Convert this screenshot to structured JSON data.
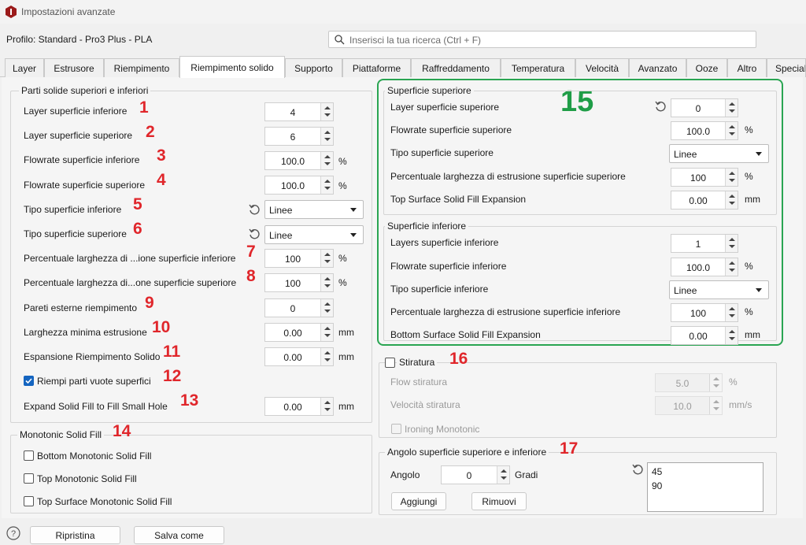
{
  "window": {
    "title": "Impostazioni avanzate"
  },
  "profile": {
    "label": "Profilo: Standard - Pro3 Plus - PLA"
  },
  "search": {
    "placeholder": "Inserisci la tua ricerca (Ctrl + F)"
  },
  "tabs": [
    {
      "label": "Layer"
    },
    {
      "label": "Estrusore"
    },
    {
      "label": "Riempimento"
    },
    {
      "label": "Riempimento solido"
    },
    {
      "label": "Supporto"
    },
    {
      "label": "Piattaforme"
    },
    {
      "label": "Raffreddamento"
    },
    {
      "label": "Temperatura"
    },
    {
      "label": "Velocità"
    },
    {
      "label": "Avanzato"
    },
    {
      "label": "Ooze"
    },
    {
      "label": "Altro"
    },
    {
      "label": "Special"
    }
  ],
  "left_group": {
    "title": "Parti solide superiori e inferiori",
    "rows": [
      {
        "label": "Layer superficie inferiore",
        "value": "4",
        "marker": "1"
      },
      {
        "label": "Layer superficie superiore",
        "value": "6",
        "marker": "2"
      },
      {
        "label": "Flowrate superficie inferiore",
        "value": "100.0",
        "unit": "%",
        "marker": "3"
      },
      {
        "label": "Flowrate superficie superiore",
        "value": "100.0",
        "unit": "%",
        "marker": "4"
      },
      {
        "label": "Tipo superficie inferiore",
        "value": "Linee",
        "marker": "5"
      },
      {
        "label": "Tipo superficie superiore",
        "value": "Linee",
        "marker": "6"
      },
      {
        "label": "Percentuale larghezza di ...ione superficie inferiore",
        "value": "100",
        "unit": "%",
        "marker": "7"
      },
      {
        "label": "Percentuale larghezza di...one superficie superiore",
        "value": "100",
        "unit": "%",
        "marker": "8"
      },
      {
        "label": "Pareti esterne riempimento",
        "value": "0",
        "marker": "9"
      },
      {
        "label": "Larghezza minima estrusione",
        "value": "0.00",
        "unit": "mm",
        "marker": "10"
      },
      {
        "label": "Espansione Riempimento Solido",
        "value": "0.00",
        "unit": "mm",
        "marker": "11"
      },
      {
        "label": "Riempi parti vuote superfici",
        "checked": true,
        "marker": "12"
      },
      {
        "label": "Expand Solid Fill to Fill Small Hole",
        "value": "0.00",
        "unit": "mm",
        "marker": "13"
      }
    ]
  },
  "monotonic": {
    "title": "Monotonic Solid Fill",
    "marker": "14",
    "items": [
      {
        "label": "Bottom Monotonic Solid Fill",
        "checked": false
      },
      {
        "label": "Top Monotonic Solid Fill",
        "checked": false
      },
      {
        "label": "Top Surface Monotonic Solid Fill",
        "checked": false
      }
    ]
  },
  "green_marker": "15",
  "top_surface": {
    "title": "Superficie superiore",
    "rows": [
      {
        "label": "Layer superficie superiore",
        "value": "0"
      },
      {
        "label": "Flowrate superficie superiore",
        "value": "100.0",
        "unit": "%"
      },
      {
        "label": "Tipo superficie superiore",
        "value": "Linee"
      },
      {
        "label": "Percentuale larghezza di estrusione superficie superiore",
        "value": "100",
        "unit": "%"
      },
      {
        "label": "Top Surface Solid Fill Expansion",
        "value": "0.00",
        "unit": "mm"
      }
    ]
  },
  "bottom_surface": {
    "title": "Superficie inferiore",
    "rows": [
      {
        "label": "Layers superficie inferiore",
        "value": "1"
      },
      {
        "label": "Flowrate superficie inferiore",
        "value": "100.0",
        "unit": "%"
      },
      {
        "label": "Tipo superficie inferiore",
        "value": "Linee"
      },
      {
        "label": "Percentuale larghezza di estrusione superficie inferiore",
        "value": "100",
        "unit": "%"
      },
      {
        "label": "Bottom Surface Solid Fill Expansion",
        "value": "0.00",
        "unit": "mm"
      }
    ]
  },
  "ironing": {
    "title": "Stiratura",
    "marker": "16",
    "checked": false,
    "flow_label": "Flow stiratura",
    "flow_value": "5.0",
    "flow_unit": "%",
    "speed_label": "Velocità stiratura",
    "speed_value": "10.0",
    "speed_unit": "mm/s",
    "monotonic_label": "Ironing Monotonic"
  },
  "angle": {
    "title": "Angolo superficie superiore e inferiore",
    "marker": "17",
    "angle_label": "Angolo",
    "angle_value": "0",
    "angle_unit": "Gradi",
    "add_label": "Aggiungi",
    "remove_label": "Rimuovi",
    "list": [
      "45",
      "90"
    ]
  },
  "bottom": {
    "reset_label": "Ripristina",
    "save_label": "Salva come"
  },
  "colors": {
    "marker_red": "#e0262b",
    "marker_green": "#1f9d47",
    "checkbox_blue": "#1565c0"
  }
}
